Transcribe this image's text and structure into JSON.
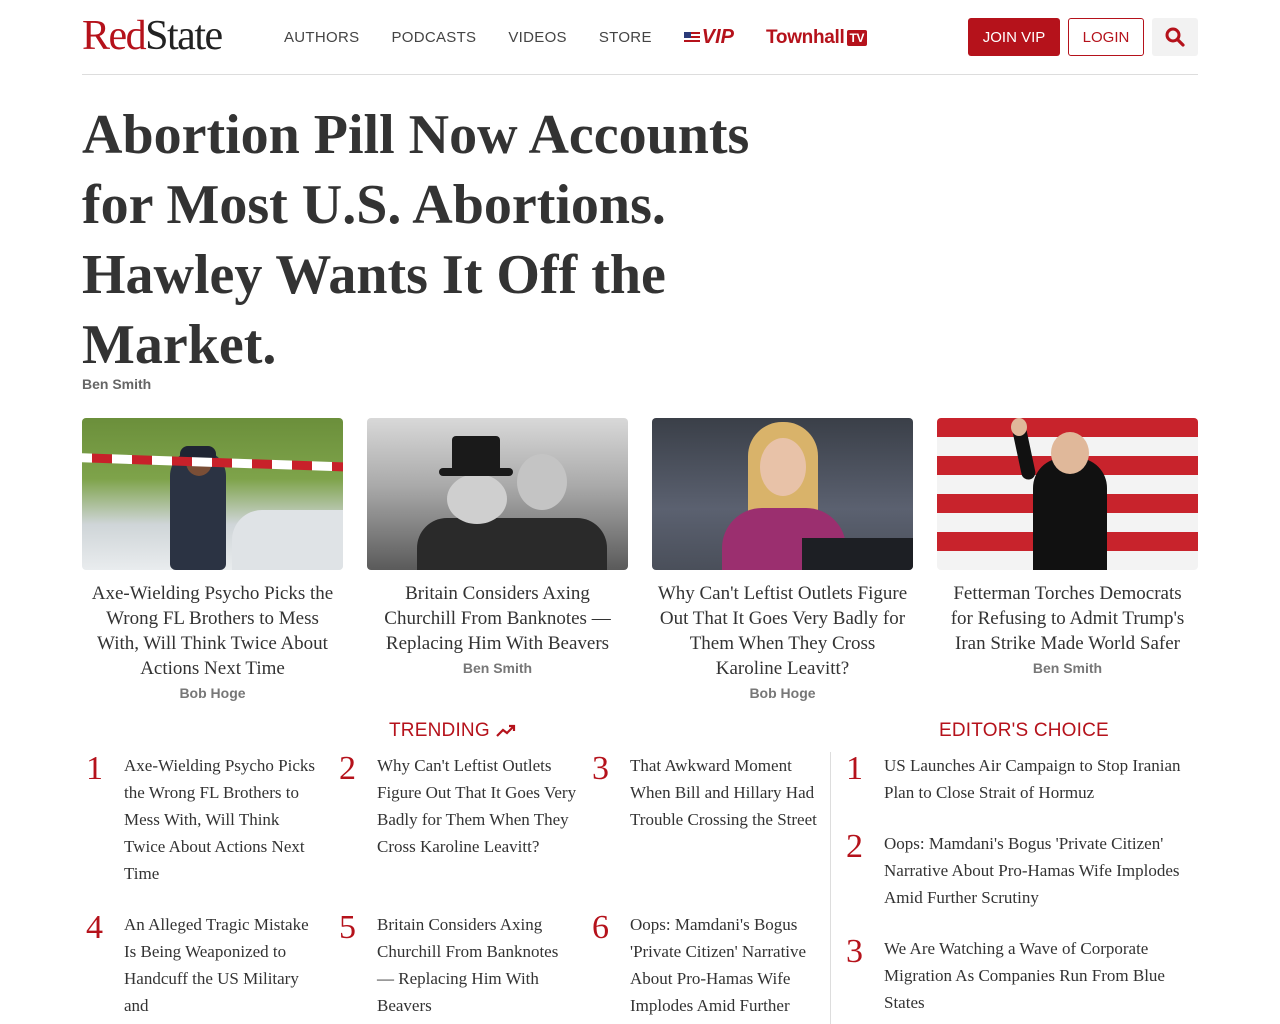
{
  "header": {
    "logo_red": "Red",
    "logo_dark": "State",
    "nav": [
      "AUTHORS",
      "PODCASTS",
      "VIDEOS",
      "STORE"
    ],
    "vip_label": "VIP",
    "townhall_label": "Townhall",
    "townhall_tv": "TV",
    "join_label": "JOIN VIP",
    "login_label": "LOGIN",
    "search_icon": "search-icon"
  },
  "article": {
    "title": "Abortion Pill Now Accounts for Most U.S. Abortions. Hawley Wants It Off the Market.",
    "author": "Ben Smith"
  },
  "cards": [
    {
      "title": "Axe-Wielding Psycho Picks the Wrong FL Brothers to Mess With, Will Think Twice About Actions Next Time",
      "author": "Bob Hoge"
    },
    {
      "title": "Britain Considers Axing Churchill From Banknotes — Replacing Him With Beavers",
      "author": "Ben Smith"
    },
    {
      "title": "Why Can't Leftist Outlets Figure Out That It Goes Very Badly for Them When They Cross Karoline Leavitt?",
      "author": "Bob Hoge"
    },
    {
      "title": "Fetterman Torches Democrats for Refusing to Admit Trump's Iran Strike Made World Safer",
      "author": "Ben Smith"
    }
  ],
  "trending": {
    "heading": "TRENDING",
    "items": [
      {
        "num": "1",
        "text": "Axe-Wielding Psycho Picks the Wrong FL Brothers to Mess With, Will Think Twice About Actions Next Time"
      },
      {
        "num": "2",
        "text": "Why Can't Leftist Outlets Figure Out That It Goes Very Badly for Them When They Cross Karoline Leavitt?"
      },
      {
        "num": "3",
        "text": "That Awkward Moment When Bill and Hillary Had Trouble Crossing the Street"
      },
      {
        "num": "4",
        "text": "An Alleged Tragic Mistake Is Being Weaponized to Handcuff the US Military and"
      },
      {
        "num": "5",
        "text": "Britain Considers Axing Churchill From Banknotes — Replacing Him With Beavers"
      },
      {
        "num": "6",
        "text": "Oops: Mamdani's Bogus 'Private Citizen' Narrative About Pro-Hamas Wife Implodes Amid Further"
      }
    ]
  },
  "editors_choice": {
    "heading": "EDITOR'S CHOICE",
    "items": [
      {
        "num": "1",
        "text": "US Launches Air Campaign to Stop Iranian Plan to Close Strait of Hormuz"
      },
      {
        "num": "2",
        "text": "Oops: Mamdani's Bogus 'Private Citizen' Narrative About Pro-Hamas Wife Implodes Amid Further Scrutiny"
      },
      {
        "num": "3",
        "text": "We Are Watching a Wave of Corporate Migration As Companies Run From Blue States"
      }
    ]
  },
  "colors": {
    "brand_red": "#b5121b",
    "text": "#333333"
  }
}
